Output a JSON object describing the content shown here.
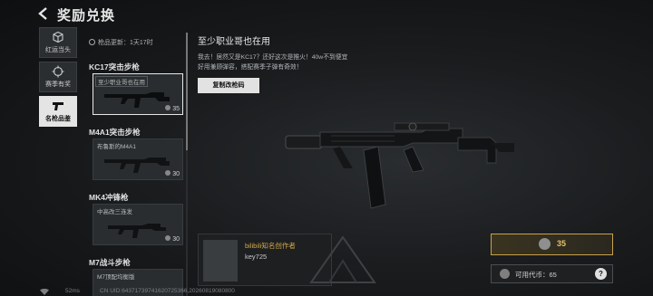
{
  "header": {
    "title": "奖励兑换"
  },
  "tabs": [
    {
      "label": "红运当头",
      "icon": "box-icon",
      "active": false
    },
    {
      "label": "赛季有奖",
      "icon": "target-icon",
      "active": false
    },
    {
      "label": "名枪品鉴",
      "icon": "pistol-icon",
      "active": true
    }
  ],
  "list": {
    "refresh_text": "枪品更新：1天17时",
    "items": [
      {
        "title": "KC17突击步枪",
        "skin": "至少职业哥也在用",
        "price": "35",
        "selected": true
      },
      {
        "title": "M4A1突击步枪",
        "skin": "布鲁斯的M4A1",
        "price": "30",
        "selected": false
      },
      {
        "title": "MK4冲锋枪",
        "skin": "中高改三连发",
        "price": "30",
        "selected": false
      },
      {
        "title": "M7战斗步枪",
        "skin": "M7顶配均衡版",
        "price": "",
        "selected": false
      }
    ]
  },
  "detail": {
    "title": "至少职业哥也在用",
    "description": "我去！居然又是KC17？还好这次是推火！40w不到便宜好用兼顾弹容，搭配赛季子弹有奇效！",
    "copy_button": "复制改枪码"
  },
  "creator": {
    "name": "bilibili知名创作者",
    "code": "key725"
  },
  "purchase": {
    "price": "35",
    "available_label": "可用代币：",
    "available_value": "65",
    "help": "?"
  },
  "status": {
    "ping": "52ms",
    "uid": "CN UID:64371739741620725366,20260819080800"
  },
  "colors": {
    "accent_gold": "#c9a24a",
    "selected_border": "#e8e8e8"
  }
}
